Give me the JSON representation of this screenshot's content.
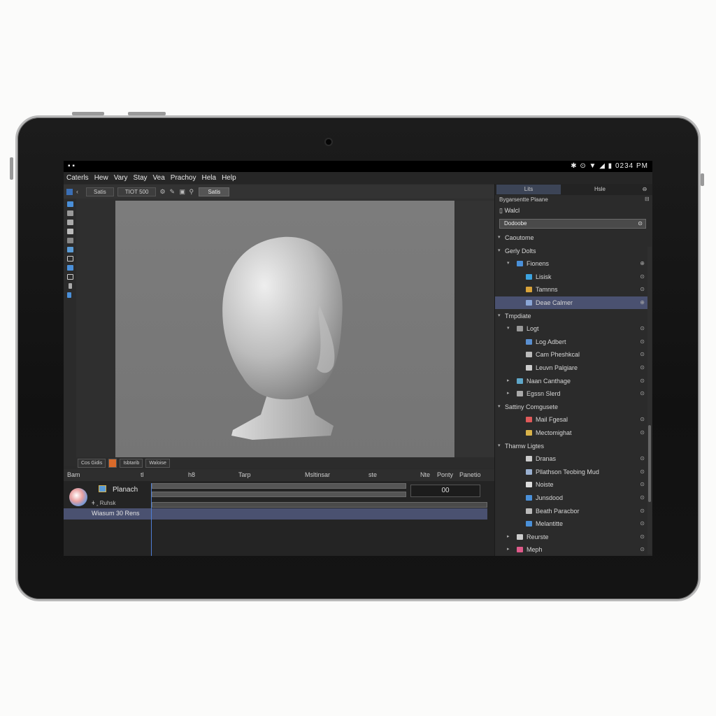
{
  "status": {
    "left_icons": "▪ ▪",
    "time": "0234 PM",
    "indicators": "✱ ⊙ ▼ ◢ ▮"
  },
  "menu": [
    "Caterls",
    "Hew",
    "Vary",
    "Stay",
    "Vea",
    "Prachoy",
    "Hela",
    "Help"
  ],
  "toolbar": {
    "field1": "Satis",
    "field2": "TIOT 500",
    "button": "Satis"
  },
  "viewport_bar": [
    "Cos Gidis",
    "Isbtarib",
    "Waloise"
  ],
  "timeline": {
    "header": [
      "Bam",
      "tl",
      "h8",
      "Tarp",
      "Msltinsar",
      "ste",
      "Nte",
      "Ponty",
      "Panetio"
    ],
    "object_name": "Planach",
    "row_label": "ǂ ꞈ Ruhsk",
    "selected_row": "Wiasum 30 Rens",
    "value": "00"
  },
  "panel": {
    "tabs": [
      "Lits",
      "Hsle"
    ],
    "header": "Bygarsentte Plaane",
    "sub_header": "Walcl",
    "search_value": "Dodoobe",
    "items": [
      {
        "label": "Caoutome",
        "indent": 0,
        "arrow": "▾",
        "icon": "",
        "eye": ""
      },
      {
        "label": "Gerly Dolts",
        "indent": 0,
        "arrow": "▾",
        "icon": "",
        "eye": ""
      },
      {
        "label": "Fionens",
        "indent": 1,
        "arrow": "▾",
        "icon": "#4a90d9",
        "eye": "⊕"
      },
      {
        "label": "Lisisk",
        "indent": 2,
        "arrow": "",
        "icon": "#3ca3e0",
        "eye": "⊙"
      },
      {
        "label": "Tamnns",
        "indent": 2,
        "arrow": "",
        "icon": "#d9a33a",
        "eye": "⊙"
      },
      {
        "label": "Deae Calmer",
        "indent": 2,
        "arrow": "",
        "icon": "#8aa6d6",
        "eye": "⊕",
        "selected": true
      },
      {
        "label": "Tmpdiate",
        "indent": 0,
        "arrow": "▾",
        "icon": "",
        "eye": ""
      },
      {
        "label": "Logt",
        "indent": 1,
        "arrow": "▾",
        "icon": "#999999",
        "eye": "⊙"
      },
      {
        "label": "Log Adbert",
        "indent": 2,
        "arrow": "",
        "icon": "#5a8fd0",
        "eye": "⊙"
      },
      {
        "label": "Cam Pheshkcal",
        "indent": 2,
        "arrow": "",
        "icon": "#bbbbbb",
        "eye": "⊙"
      },
      {
        "label": "Leuvn Palgiare",
        "indent": 2,
        "arrow": "",
        "icon": "#cccccc",
        "eye": "⊙"
      },
      {
        "label": "Naan Canthage",
        "indent": 1,
        "arrow": "▸",
        "icon": "#5fa7c9",
        "eye": "⊙"
      },
      {
        "label": "Egssn Slerd",
        "indent": 1,
        "arrow": "▸",
        "icon": "#aaaaaa",
        "eye": "⊙"
      },
      {
        "label": "Sattiny Comgusete",
        "indent": 0,
        "arrow": "▾",
        "icon": "",
        "eye": ""
      },
      {
        "label": "Mail Fgesal",
        "indent": 2,
        "arrow": "",
        "icon": "#e05a5a",
        "eye": "⊙"
      },
      {
        "label": "Mectomighat",
        "indent": 2,
        "arrow": "",
        "icon": "#d9b34a",
        "eye": "⊙"
      },
      {
        "label": "Thamw Ligtes",
        "indent": 0,
        "arrow": "▾",
        "icon": "",
        "eye": ""
      },
      {
        "label": "Dranas",
        "indent": 2,
        "arrow": "",
        "icon": "#cccccc",
        "eye": "⊙"
      },
      {
        "label": "Pllathson Teobing Mud",
        "indent": 2,
        "arrow": "",
        "icon": "#9ab0d0",
        "eye": "⊙"
      },
      {
        "label": "Noiste",
        "indent": 2,
        "arrow": "",
        "icon": "#dddddd",
        "eye": "⊙"
      },
      {
        "label": "Junsdood",
        "indent": 2,
        "arrow": "",
        "icon": "#4a90d9",
        "eye": "⊙"
      },
      {
        "label": "Beath Paracbor",
        "indent": 2,
        "arrow": "",
        "icon": "#bbbbbb",
        "eye": "⊙"
      },
      {
        "label": "Melantitte",
        "indent": 2,
        "arrow": "",
        "icon": "#4a90d9",
        "eye": "⊙"
      },
      {
        "label": "Reurste",
        "indent": 1,
        "arrow": "▸",
        "icon": "#cccccc",
        "eye": "⊙"
      },
      {
        "label": "Meph",
        "indent": 1,
        "arrow": "▸",
        "icon": "#e05a8a",
        "eye": "⊙"
      }
    ]
  },
  "colors": {
    "selection": "#4a5170",
    "accent": "#4f7fd6"
  }
}
